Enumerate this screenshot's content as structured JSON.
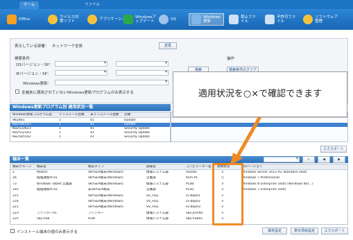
{
  "tabs": [
    {
      "label": "ホーム",
      "active": true
    },
    {
      "label": "ファイル",
      "active": false
    }
  ],
  "ribbon": [
    {
      "label": "Office",
      "icon": "office-icon",
      "color": "#f4a020"
    },
    {
      "label": "ウイルス対策ソフト",
      "icon": "antivirus-icon",
      "color": "#f6c23a"
    },
    {
      "label": "アプリケーション",
      "icon": "app-icon",
      "color": "#f6c23a"
    },
    {
      "label": "Windowsアップデート",
      "icon": "windows-update-icon",
      "color": "#2aa84a"
    },
    {
      "label": "OS",
      "icon": "os-icon",
      "color": "#9fc4ea"
    },
    {
      "label": "Windows更新",
      "icon": "windows-patch-icon",
      "color": "#7fb5e8",
      "selected": true
    },
    {
      "label": "禁止ファイル",
      "icon": "banned-file-icon",
      "color": "#cfe1f4"
    },
    {
      "label": "不許可ファイル",
      "icon": "denied-file-icon",
      "color": "#cfe1f4"
    },
    {
      "label": "ソフトウェア管理",
      "icon": "software-icon",
      "color": "#f6c23a"
    }
  ],
  "filter": {
    "network_label": "表示している部署：",
    "network_value": "ネットワーク全体",
    "network_button": "変更",
    "group_title": "検索条件",
    "os_version_label": "OSバージョン・SP：",
    "os_version2_label": "IEバージョン・SP：",
    "windows_update_label": "Windows更新：",
    "checkbox_label": "全端末に適用されていないWindows更新プログラムのみ表示する",
    "search_button": "検索",
    "right_group_title": "操作",
    "right_button": "検索条件のクリア"
  },
  "update_section": {
    "title": "Windows更新プログラム別 適用状況一覧",
    "columns": [
      "Windows更新プログラム名",
      "インストール台数",
      "未インストール台数",
      "分類"
    ],
    "rows": [
      [
        "982861",
        "1",
        "41",
        "Update"
      ],
      [
        "KB2506143",
        "1",
        "41",
        "Update"
      ],
      [
        "KB2533623",
        "1",
        "41",
        "Security Update"
      ],
      [
        "KB2552343",
        "1",
        "41",
        "Security Update"
      ],
      [
        "KB2585542",
        "1",
        "41",
        "Security Update"
      ]
    ],
    "export_button": "エクスポート"
  },
  "device_section": {
    "title": "端末一覧",
    "search_placeholder": "",
    "columns": [
      "端末グループ",
      "端末名",
      "端末タイプ",
      "部署名",
      "コンピューター名",
      "適用状況",
      "OSバージョン"
    ],
    "rows": [
      [
        "2",
        "Master",
        "SKYSEA端末(Windows)",
        "情報システム部",
        "master",
        "×",
        "Windows Server 2012 R2 Standard (x64)"
      ],
      [
        "26",
        "経理課長PC01",
        "SKYSEA端末(Windows)",
        "営業部",
        "tech-PC",
        "○",
        "Windows 7 Professional"
      ],
      [
        "73",
        "Windows Tablet 営業部",
        "SKYSEA端末(Windows)",
        "情報システム部",
        "PC80",
        "×",
        "Windows 8 Enterprise (x64) (Windows 8の…)"
      ],
      [
        "191",
        "経理課長PC02",
        "非SKYSEA端末",
        "営業部",
        "PC81",
        "×",
        "Windows 7 Enterprise (x64)"
      ],
      [
        "215",
        "",
        "SKYSEA端末(Windows)",
        "SV_FILE",
        "sv-bkp01",
        "×",
        ""
      ],
      [
        "216",
        "",
        "SKYSEA端末(Windows)",
        "SV_FILE",
        "sv-bkp02",
        "×",
        ""
      ],
      [
        "221",
        "",
        "SKYSEA端末(Windows)",
        "SV_FILE",
        "sv-bkp03",
        "×",
        ""
      ],
      [
        "223",
        "プリンター01",
        "プリンター",
        "情報システム部",
        "Sky-printer",
        "×",
        ""
      ],
      [
        "225",
        "Sky-hub",
        "HUB",
        "情報システム部",
        "Sky-hub01",
        "×",
        ""
      ]
    ],
    "checkbox_label": "インストール端末の値のみ表示する",
    "buttons": [
      "端末設定",
      "表示項目設定",
      "エクスポート"
    ]
  },
  "callout_text": "適用状況を○×で確認できます"
}
